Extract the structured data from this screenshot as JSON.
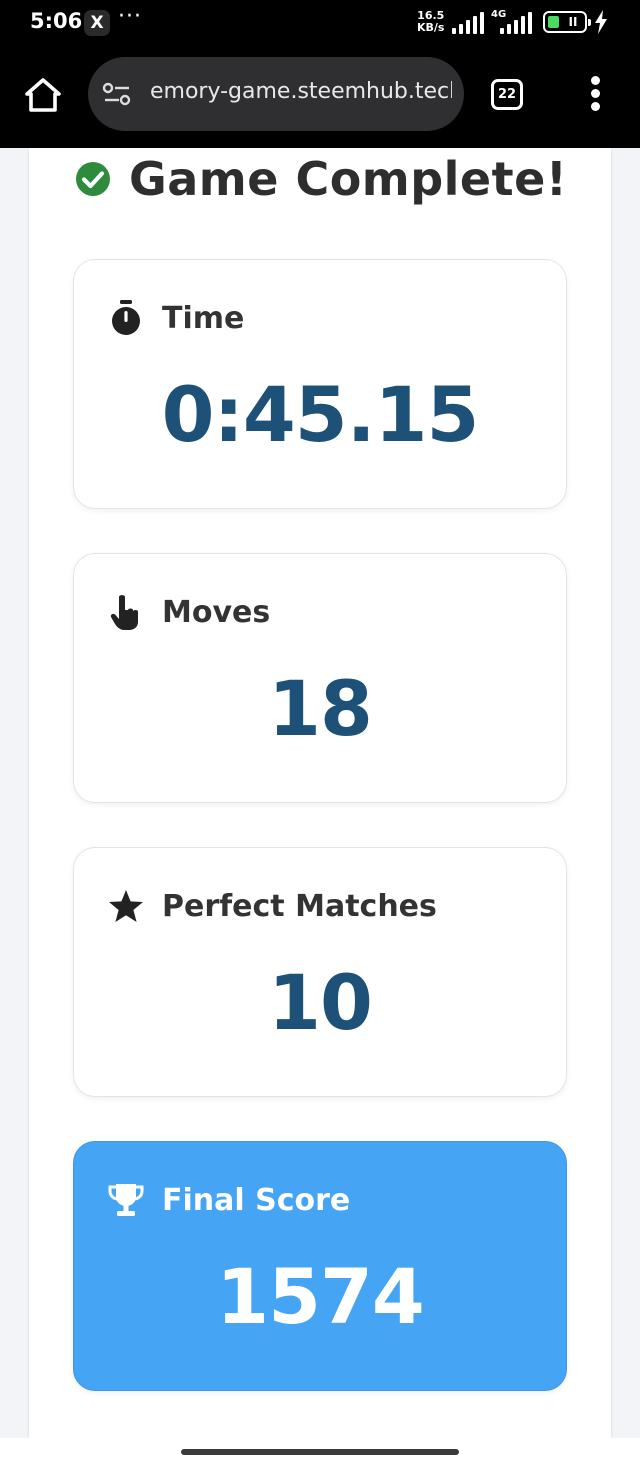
{
  "status_bar": {
    "time": "5:06",
    "app_icon": "X",
    "more": "···",
    "speed_value": "16.5",
    "speed_unit": "KB/s",
    "network": "4G",
    "battery_label": "II",
    "battery_level": 0.3
  },
  "browser": {
    "url": "emory-game.steemhub.tech",
    "tab_count": "22"
  },
  "game": {
    "title": "Game Complete!",
    "title_icon": "check-circle-icon",
    "stats": [
      {
        "icon": "stopwatch-icon",
        "label": "Time",
        "value": "0:45.15"
      },
      {
        "icon": "tap-hand-icon",
        "label": "Moves",
        "value": "18"
      },
      {
        "icon": "star-icon",
        "label": "Perfect Matches",
        "value": "10"
      },
      {
        "icon": "trophy-icon",
        "label": "Final Score",
        "value": "1574"
      }
    ]
  },
  "colors": {
    "value_text": "#1d5177",
    "final_card": "#45a5f4",
    "check": "#2e8b3e"
  }
}
